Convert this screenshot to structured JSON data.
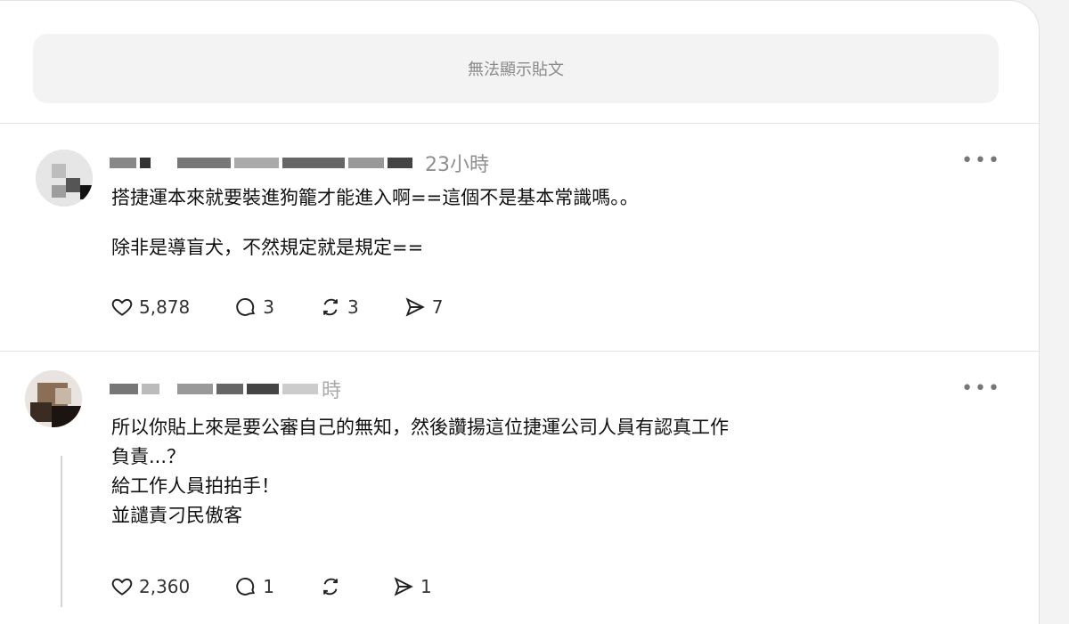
{
  "notice": {
    "unavailable_text": "無法顯示貼文"
  },
  "posts": [
    {
      "time": "23小時",
      "lines": [
        "搭捷運本來就要裝進狗籠才能進入啊==這個不是基本常識嗎。。",
        "除非是導盲犬，不然規定就是規定=="
      ],
      "likes": "5,878",
      "replies": "3",
      "reposts": "3",
      "shares": "7"
    },
    {
      "time": "時",
      "lines": [
        "所以你貼上來是要公審自己的無知，然後讚揚這位捷運公司人員有認真工作",
        "負責...？",
        "給工作人員拍拍手！",
        "並譴責刁民傲客"
      ],
      "likes": "2,360",
      "replies": "1",
      "reposts": "",
      "shares": "1"
    }
  ],
  "icons": {
    "like": "heart-icon",
    "reply": "comment-icon",
    "repost": "repost-icon",
    "share": "send-icon",
    "more": "more-icon"
  }
}
